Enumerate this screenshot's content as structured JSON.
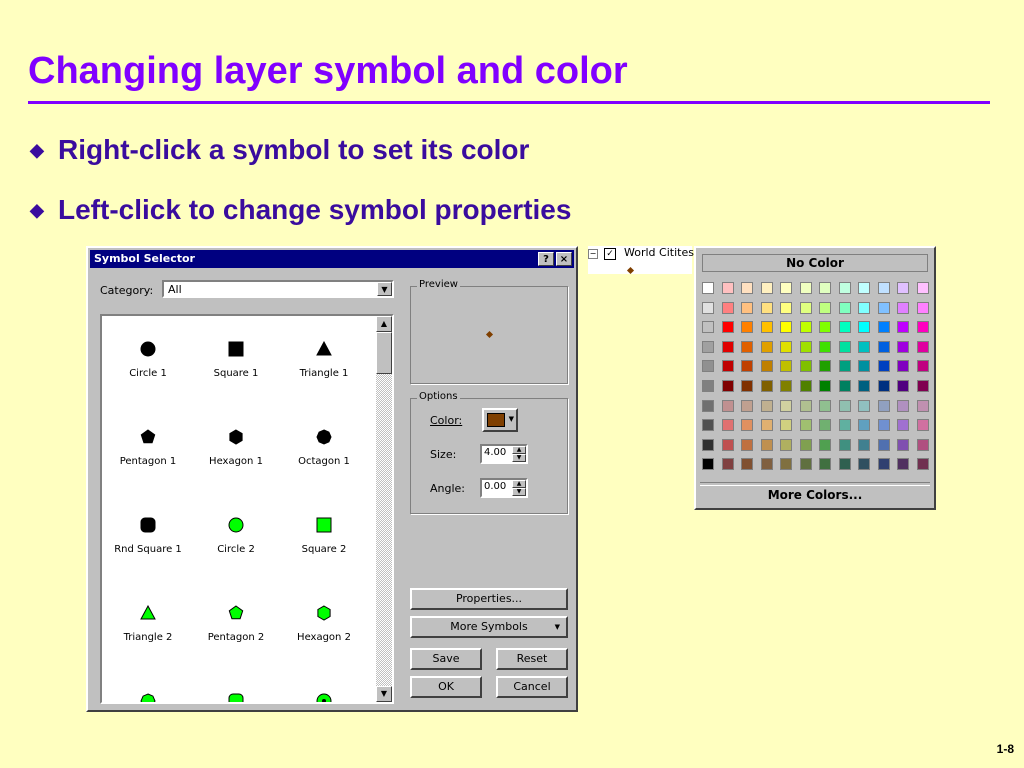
{
  "slide": {
    "title": "Changing layer symbol and color",
    "bullets": [
      "Right-click a symbol to set its color",
      "Left-click to change symbol properties"
    ],
    "page_number": "1-8"
  },
  "dialog": {
    "title": "Symbol Selector",
    "help_button": "?",
    "close_button": "×",
    "category_label": "Category:",
    "category_value": "All",
    "symbols": [
      {
        "label": "Circle 1",
        "shape": "circle",
        "color": "#000000"
      },
      {
        "label": "Square 1",
        "shape": "square",
        "color": "#000000"
      },
      {
        "label": "Triangle 1",
        "shape": "triangle",
        "color": "#000000"
      },
      {
        "label": "Pentagon 1",
        "shape": "pentagon",
        "color": "#000000"
      },
      {
        "label": "Hexagon 1",
        "shape": "hexagon",
        "color": "#000000"
      },
      {
        "label": "Octagon 1",
        "shape": "octagon",
        "color": "#000000"
      },
      {
        "label": "Rnd Square 1",
        "shape": "rounded-square",
        "color": "#000000"
      },
      {
        "label": "Circle 2",
        "shape": "circle",
        "color": "#00FF00"
      },
      {
        "label": "Square 2",
        "shape": "square",
        "color": "#00FF00"
      },
      {
        "label": "Triangle 2",
        "shape": "triangle",
        "color": "#00FF00"
      },
      {
        "label": "Pentagon 2",
        "shape": "pentagon",
        "color": "#00FF00"
      },
      {
        "label": "Hexagon 2",
        "shape": "hexagon",
        "color": "#00FF00"
      },
      {
        "label": "",
        "shape": "octagon",
        "color": "#00FF00"
      },
      {
        "label": "",
        "shape": "rounded-square",
        "color": "#00FF00"
      },
      {
        "label": "",
        "shape": "circle-dot",
        "color": "#00FF00"
      }
    ],
    "preview_label": "Preview",
    "options_label": "Options",
    "color_label": "Color:",
    "color_value": "#7F3F00",
    "size_label": "Size:",
    "size_value": "4.00",
    "angle_label": "Angle:",
    "angle_value": "0.00",
    "properties_button": "Properties...",
    "more_symbols_button": "More Symbols",
    "save_button": "Save",
    "reset_button": "Reset",
    "ok_button": "OK",
    "cancel_button": "Cancel"
  },
  "toc": {
    "layer_name": "World Citites",
    "checked": true
  },
  "palette": {
    "no_color": "No Color",
    "more_colors": "More Colors...",
    "rows": [
      [
        "#FFFFFF",
        "#FFC0C0",
        "#FFE0C0",
        "#FFF0C0",
        "#FFFFC0",
        "#F0FFC0",
        "#E0FFC0",
        "#C0FFE0",
        "#C0FFFF",
        "#C0E0FF",
        "#E0C0FF",
        "#FFC0FF"
      ],
      [
        "#E0E0E0",
        "#FF8080",
        "#FFC080",
        "#FFE080",
        "#FFFF80",
        "#E0FF80",
        "#C0FF80",
        "#80FFC0",
        "#80FFFF",
        "#80C0FF",
        "#E080FF",
        "#FF80FF"
      ],
      [
        "#C0C0C0",
        "#FF0000",
        "#FF8000",
        "#FFC000",
        "#FFFF00",
        "#C0FF00",
        "#80FF00",
        "#00FFC0",
        "#00FFFF",
        "#0080FF",
        "#C000FF",
        "#FF00C0"
      ],
      [
        "#A0A0A0",
        "#E00000",
        "#E06000",
        "#E0A000",
        "#E0E000",
        "#A0E000",
        "#40E000",
        "#00E0A0",
        "#00C0C0",
        "#0060E0",
        "#A000E0",
        "#E000A0"
      ],
      [
        "#909090",
        "#C00000",
        "#C04000",
        "#C08000",
        "#C0C000",
        "#80C000",
        "#20A000",
        "#00A080",
        "#0090A0",
        "#0040C0",
        "#8000C0",
        "#C00080"
      ],
      [
        "#808080",
        "#800000",
        "#803000",
        "#806000",
        "#808000",
        "#508000",
        "#008000",
        "#008060",
        "#006080",
        "#003080",
        "#500080",
        "#800050"
      ],
      [
        "#707070",
        "#C09090",
        "#C0A090",
        "#C0B090",
        "#D0D0A0",
        "#B0C090",
        "#90C090",
        "#90C0B0",
        "#90C0C0",
        "#90A0C0",
        "#B090C0",
        "#C090B0"
      ],
      [
        "#505050",
        "#E07070",
        "#E09060",
        "#E0B070",
        "#D0D080",
        "#A0C070",
        "#70B070",
        "#60B0A0",
        "#60A0C0",
        "#7090D0",
        "#A070D0",
        "#D070A0"
      ],
      [
        "#303030",
        "#C05050",
        "#C07040",
        "#C09050",
        "#B0B060",
        "#80A050",
        "#50A050",
        "#409080",
        "#408090",
        "#5070B0",
        "#8050B0",
        "#B05080"
      ],
      [
        "#000000",
        "#804040",
        "#805030",
        "#806040",
        "#807040",
        "#607040",
        "#407040",
        "#306050",
        "#305060",
        "#304070",
        "#503060",
        "#703050"
      ]
    ]
  }
}
